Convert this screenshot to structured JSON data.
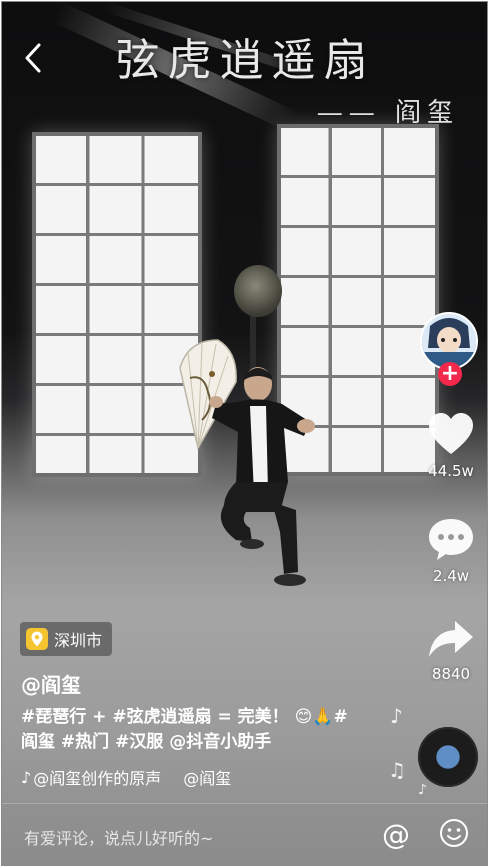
{
  "video": {
    "title": "弦虎逍遥扇",
    "subtitle": "—— 阎玺"
  },
  "actions": {
    "likes": "44.5w",
    "comments": "2.4w",
    "shares": "8840"
  },
  "post": {
    "location": "深圳市",
    "username": "@阎玺",
    "caption_line1": "#琵琶行 + #弦虎逍遥扇 = 完美！ 😊🙏#",
    "caption_line2": "阎玺 #热门 #汉服 @抖音小助手",
    "music_source": "@阎玺创作的原声",
    "music_author": "@阎玺"
  },
  "comment": {
    "placeholder": "有爱评论，说点儿好听的~"
  },
  "colors": {
    "follow_accent": "#f2294b",
    "location_pin": "#f5c531"
  },
  "icons": [
    "back-icon",
    "plus-icon",
    "heart-icon",
    "comment-icon",
    "share-icon",
    "music-note-icon",
    "location-pin-icon",
    "tiktok-note-icon",
    "at-icon",
    "emoji-icon"
  ]
}
